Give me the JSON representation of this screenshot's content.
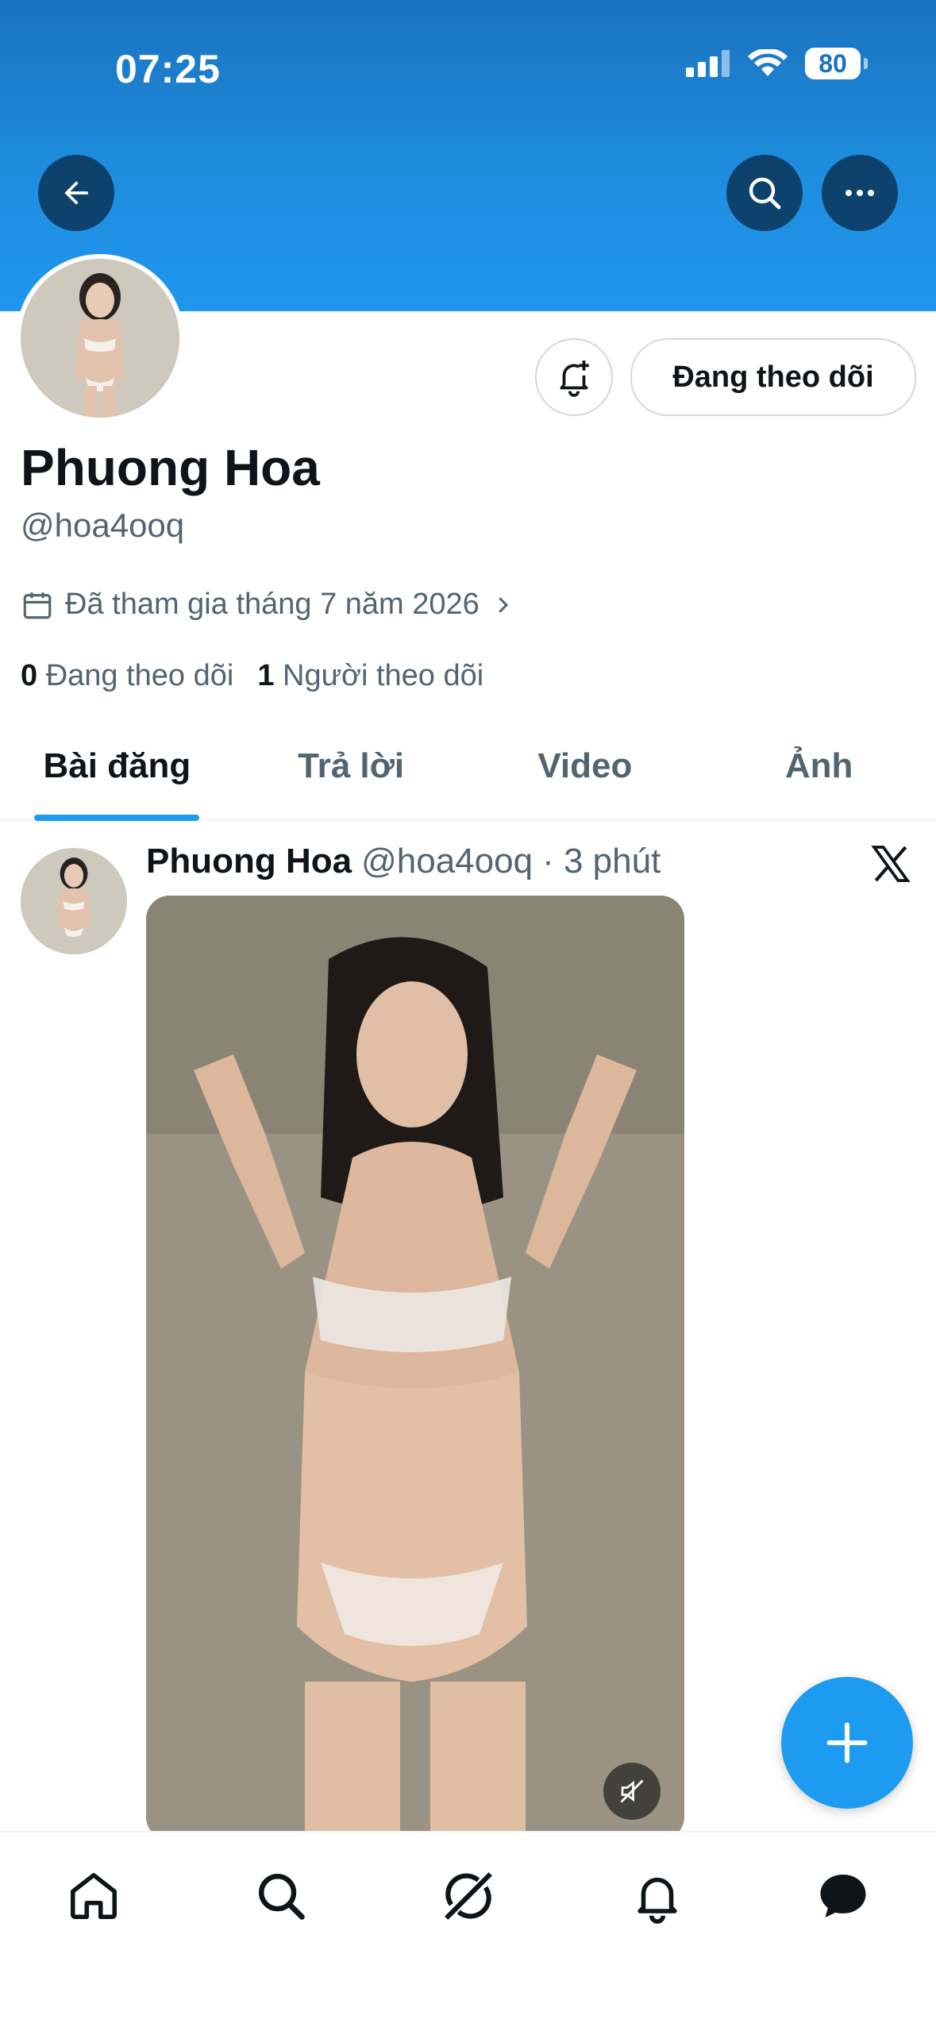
{
  "status_bar": {
    "time": "07:25",
    "battery": "80"
  },
  "profile": {
    "name": "Phuong Hoa",
    "handle": "@hoa4ooq",
    "joined": "Đã tham gia tháng 7 năm 2026",
    "following_count": "0",
    "following_label": "Đang theo dõi",
    "followers_count": "1",
    "followers_label": "Người theo dõi",
    "follow_button": "Đang theo dõi"
  },
  "tabs": [
    {
      "label": "Bài đăng",
      "active": true
    },
    {
      "label": "Trả lời",
      "active": false
    },
    {
      "label": "Video",
      "active": false
    },
    {
      "label": "Ảnh",
      "active": false
    }
  ],
  "post": {
    "name": "Phuong Hoa",
    "handle": "@hoa4ooq",
    "time": "· 3 phút"
  },
  "colors": {
    "accent": "#1d9bf0",
    "text": "#0f1419",
    "muted": "#536471"
  },
  "icons": [
    "back-arrow-icon",
    "search-icon",
    "more-icon",
    "bell-plus-icon",
    "calendar-icon",
    "chevron-right-icon",
    "x-logo-icon",
    "mute-icon",
    "plus-icon",
    "home-icon",
    "grok-icon",
    "notifications-icon",
    "messages-icon"
  ]
}
